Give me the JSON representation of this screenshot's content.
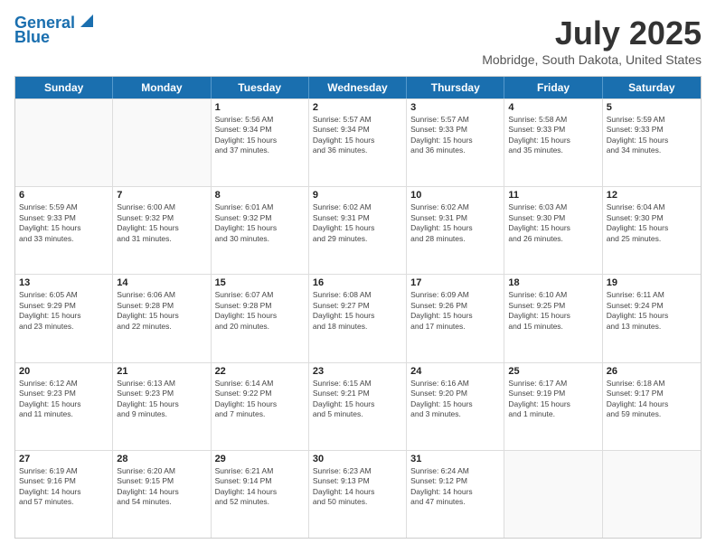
{
  "logo": {
    "line1": "General",
    "line2": "Blue"
  },
  "title": "July 2025",
  "subtitle": "Mobridge, South Dakota, United States",
  "weekdays": [
    "Sunday",
    "Monday",
    "Tuesday",
    "Wednesday",
    "Thursday",
    "Friday",
    "Saturday"
  ],
  "weeks": [
    [
      {
        "day": "",
        "info": ""
      },
      {
        "day": "",
        "info": ""
      },
      {
        "day": "1",
        "info": "Sunrise: 5:56 AM\nSunset: 9:34 PM\nDaylight: 15 hours\nand 37 minutes."
      },
      {
        "day": "2",
        "info": "Sunrise: 5:57 AM\nSunset: 9:34 PM\nDaylight: 15 hours\nand 36 minutes."
      },
      {
        "day": "3",
        "info": "Sunrise: 5:57 AM\nSunset: 9:33 PM\nDaylight: 15 hours\nand 36 minutes."
      },
      {
        "day": "4",
        "info": "Sunrise: 5:58 AM\nSunset: 9:33 PM\nDaylight: 15 hours\nand 35 minutes."
      },
      {
        "day": "5",
        "info": "Sunrise: 5:59 AM\nSunset: 9:33 PM\nDaylight: 15 hours\nand 34 minutes."
      }
    ],
    [
      {
        "day": "6",
        "info": "Sunrise: 5:59 AM\nSunset: 9:33 PM\nDaylight: 15 hours\nand 33 minutes."
      },
      {
        "day": "7",
        "info": "Sunrise: 6:00 AM\nSunset: 9:32 PM\nDaylight: 15 hours\nand 31 minutes."
      },
      {
        "day": "8",
        "info": "Sunrise: 6:01 AM\nSunset: 9:32 PM\nDaylight: 15 hours\nand 30 minutes."
      },
      {
        "day": "9",
        "info": "Sunrise: 6:02 AM\nSunset: 9:31 PM\nDaylight: 15 hours\nand 29 minutes."
      },
      {
        "day": "10",
        "info": "Sunrise: 6:02 AM\nSunset: 9:31 PM\nDaylight: 15 hours\nand 28 minutes."
      },
      {
        "day": "11",
        "info": "Sunrise: 6:03 AM\nSunset: 9:30 PM\nDaylight: 15 hours\nand 26 minutes."
      },
      {
        "day": "12",
        "info": "Sunrise: 6:04 AM\nSunset: 9:30 PM\nDaylight: 15 hours\nand 25 minutes."
      }
    ],
    [
      {
        "day": "13",
        "info": "Sunrise: 6:05 AM\nSunset: 9:29 PM\nDaylight: 15 hours\nand 23 minutes."
      },
      {
        "day": "14",
        "info": "Sunrise: 6:06 AM\nSunset: 9:28 PM\nDaylight: 15 hours\nand 22 minutes."
      },
      {
        "day": "15",
        "info": "Sunrise: 6:07 AM\nSunset: 9:28 PM\nDaylight: 15 hours\nand 20 minutes."
      },
      {
        "day": "16",
        "info": "Sunrise: 6:08 AM\nSunset: 9:27 PM\nDaylight: 15 hours\nand 18 minutes."
      },
      {
        "day": "17",
        "info": "Sunrise: 6:09 AM\nSunset: 9:26 PM\nDaylight: 15 hours\nand 17 minutes."
      },
      {
        "day": "18",
        "info": "Sunrise: 6:10 AM\nSunset: 9:25 PM\nDaylight: 15 hours\nand 15 minutes."
      },
      {
        "day": "19",
        "info": "Sunrise: 6:11 AM\nSunset: 9:24 PM\nDaylight: 15 hours\nand 13 minutes."
      }
    ],
    [
      {
        "day": "20",
        "info": "Sunrise: 6:12 AM\nSunset: 9:23 PM\nDaylight: 15 hours\nand 11 minutes."
      },
      {
        "day": "21",
        "info": "Sunrise: 6:13 AM\nSunset: 9:23 PM\nDaylight: 15 hours\nand 9 minutes."
      },
      {
        "day": "22",
        "info": "Sunrise: 6:14 AM\nSunset: 9:22 PM\nDaylight: 15 hours\nand 7 minutes."
      },
      {
        "day": "23",
        "info": "Sunrise: 6:15 AM\nSunset: 9:21 PM\nDaylight: 15 hours\nand 5 minutes."
      },
      {
        "day": "24",
        "info": "Sunrise: 6:16 AM\nSunset: 9:20 PM\nDaylight: 15 hours\nand 3 minutes."
      },
      {
        "day": "25",
        "info": "Sunrise: 6:17 AM\nSunset: 9:19 PM\nDaylight: 15 hours\nand 1 minute."
      },
      {
        "day": "26",
        "info": "Sunrise: 6:18 AM\nSunset: 9:17 PM\nDaylight: 14 hours\nand 59 minutes."
      }
    ],
    [
      {
        "day": "27",
        "info": "Sunrise: 6:19 AM\nSunset: 9:16 PM\nDaylight: 14 hours\nand 57 minutes."
      },
      {
        "day": "28",
        "info": "Sunrise: 6:20 AM\nSunset: 9:15 PM\nDaylight: 14 hours\nand 54 minutes."
      },
      {
        "day": "29",
        "info": "Sunrise: 6:21 AM\nSunset: 9:14 PM\nDaylight: 14 hours\nand 52 minutes."
      },
      {
        "day": "30",
        "info": "Sunrise: 6:23 AM\nSunset: 9:13 PM\nDaylight: 14 hours\nand 50 minutes."
      },
      {
        "day": "31",
        "info": "Sunrise: 6:24 AM\nSunset: 9:12 PM\nDaylight: 14 hours\nand 47 minutes."
      },
      {
        "day": "",
        "info": ""
      },
      {
        "day": "",
        "info": ""
      }
    ]
  ]
}
